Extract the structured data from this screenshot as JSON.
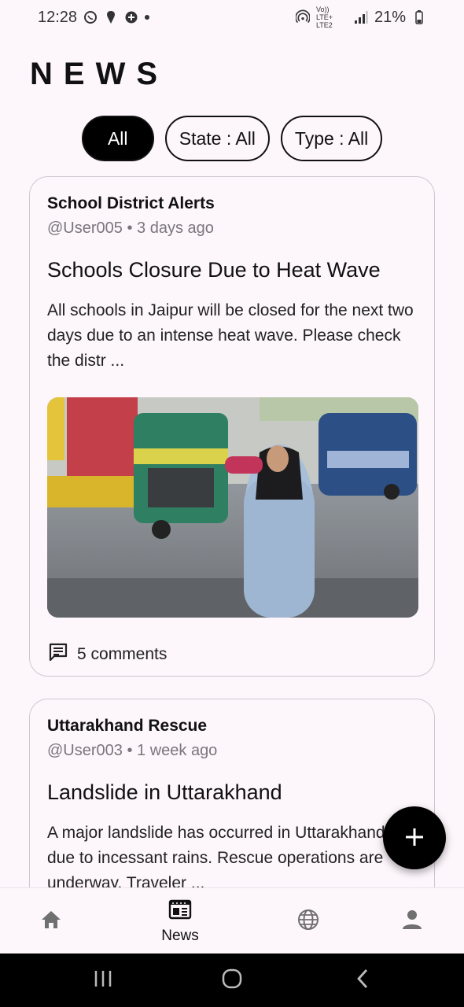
{
  "status_bar": {
    "time": "12:28",
    "network": "Vo)) LTE+ LTE2",
    "battery": "21%"
  },
  "page": {
    "title": "NEWS"
  },
  "filters": [
    {
      "label": "All",
      "selected": true
    },
    {
      "label": "State : All",
      "selected": false
    },
    {
      "label": "Type : All",
      "selected": false
    }
  ],
  "posts": [
    {
      "source": "School District Alerts",
      "meta": "@User005 • 3 days ago",
      "headline": "Schools Closure Due to Heat Wave",
      "body": "All schools in Jaipur will be closed for the next two days due to an intense heat wave. Please check the distr ...",
      "comments": "5 comments",
      "has_image": true
    },
    {
      "source": "Uttarakhand Rescue",
      "meta": "@User003 • 1 week ago",
      "headline": "Landslide in Uttarakhand",
      "body": "A major landslide has occurred in Uttarakhand due to incessant rains. Rescue operations are underway. Traveler ...",
      "has_image": false
    }
  ],
  "fab": {
    "icon": "plus-icon"
  },
  "bottom_nav": {
    "items": [
      {
        "icon": "home-icon",
        "label": ""
      },
      {
        "icon": "newspaper-icon",
        "label": "News"
      },
      {
        "icon": "globe-icon",
        "label": ""
      },
      {
        "icon": "person-icon",
        "label": ""
      }
    ],
    "active_index": 1
  },
  "colors": {
    "background": "#fdf6fb",
    "accent": "#000000",
    "muted": "#7a767c"
  }
}
